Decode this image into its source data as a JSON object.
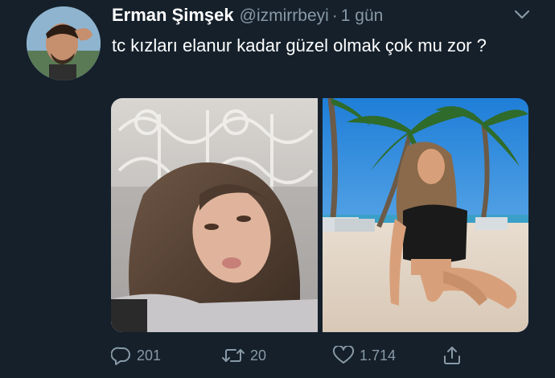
{
  "tweet": {
    "display_name": "Erman Şimşek",
    "handle": "@izmirrbeyi",
    "separator": "·",
    "time": "1 gün",
    "text": "tc kızları elanur kadar güzel olmak çok mu zor ?",
    "media": [
      {
        "name": "selfie-photo",
        "description_icon": "photo"
      },
      {
        "name": "beach-photo",
        "description_icon": "photo"
      }
    ],
    "actions": {
      "reply_count": "201",
      "retweet_count": "20",
      "like_count": "1.714"
    }
  },
  "colors": {
    "background": "#15202b",
    "text_primary": "#ffffff",
    "text_secondary": "#8899a6"
  },
  "icons": [
    "chevron-down-icon",
    "reply-icon",
    "retweet-icon",
    "like-icon",
    "share-icon"
  ]
}
